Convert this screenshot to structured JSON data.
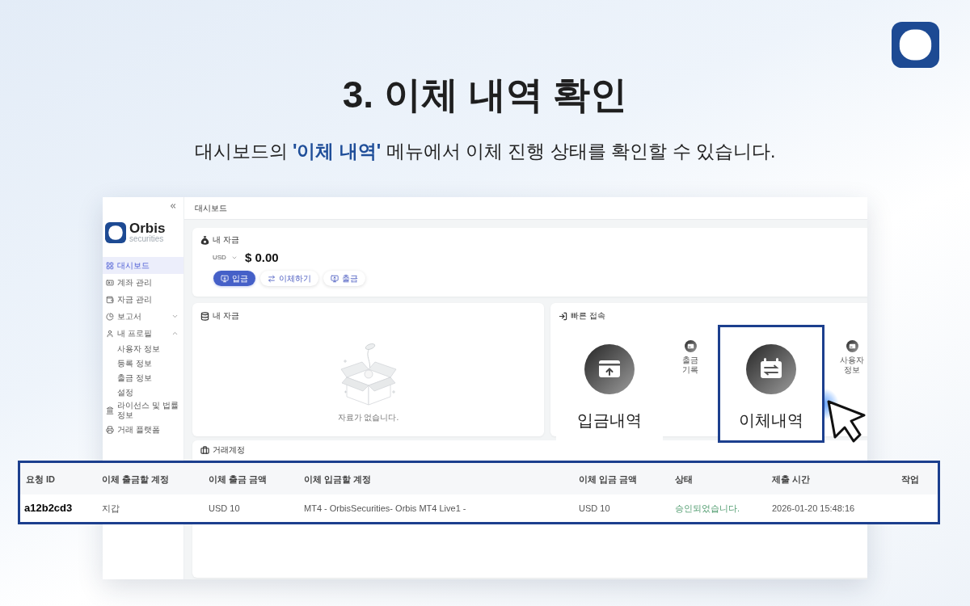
{
  "heading": {
    "title": "3. 이체 내역 확인",
    "subtitle": "대시보드의 **'이체 내역'** 메뉴에서 이체 진행 상태를 확인할 수 있습니다."
  },
  "screenshot": {
    "sidebar": {
      "brand": {
        "name": "Orbis",
        "tagline": "securities"
      },
      "items": [
        {
          "kind": "link",
          "label": "대시보드",
          "selected": true
        },
        {
          "kind": "link",
          "label": "계좌 관리",
          "selected": false
        },
        {
          "kind": "link",
          "label": "자금 관리",
          "selected": false
        },
        {
          "kind": "group",
          "label": "보고서",
          "selected": false,
          "expanded": false
        },
        {
          "kind": "group",
          "label": "내 프로필",
          "selected": false,
          "expanded": true,
          "children": [
            {
              "label": "사용자 정보",
              "selected": false
            },
            {
              "label": "등록 정보",
              "selected": false
            },
            {
              "label": "출금 정보",
              "selected": false
            },
            {
              "label": "설정",
              "selected": false
            }
          ]
        },
        {
          "kind": "link",
          "label": "라이선스 및 법률 정보",
          "selected": false
        },
        {
          "kind": "link",
          "label": "거래 플랫폼",
          "selected": false
        }
      ]
    },
    "topbar": {
      "title": "대시보드"
    },
    "balance_card": {
      "title": "내 자금",
      "currency": "USD",
      "amount": "$ 0.00",
      "buttons": [
        {
          "label": "입금",
          "kind": "primary"
        },
        {
          "label": "이체하기",
          "kind": "secondary"
        },
        {
          "label": "출금",
          "kind": "secondary"
        }
      ]
    },
    "funds_card": {
      "title": "내 자금",
      "empty_message": "자료가 없습니다."
    },
    "quick_access": {
      "title": "빠른 접속",
      "tiles": [
        {
          "label": "입금내역",
          "kind": "large",
          "highlighted": false
        },
        {
          "label": "출금 기록",
          "kind": "small",
          "highlighted": false
        },
        {
          "label": "이체내역",
          "kind": "large",
          "highlighted": true
        },
        {
          "label": "사용자 정보",
          "kind": "small",
          "highlighted": false
        }
      ]
    },
    "accounts_card": {
      "title": "거래계정"
    }
  },
  "transfer_table": {
    "columns": [
      "요청 ID",
      "이체 출금할 계정",
      "이체 출금 금액",
      "이체 입금할 계정",
      "이체 입금 금액",
      "상태",
      "제출 시간",
      "작업"
    ],
    "rows": [
      {
        "request_id": "a12b2cd3",
        "from_account": "지갑",
        "from_amount": "USD 10",
        "to_account": "MT4 - OrbisSecurities- Orbis MT4 Live1 -",
        "to_amount": "USD 10",
        "status": "승인되었습니다.",
        "approved": true,
        "submitted_at": "2026-01-20 15:48:16"
      }
    ]
  }
}
